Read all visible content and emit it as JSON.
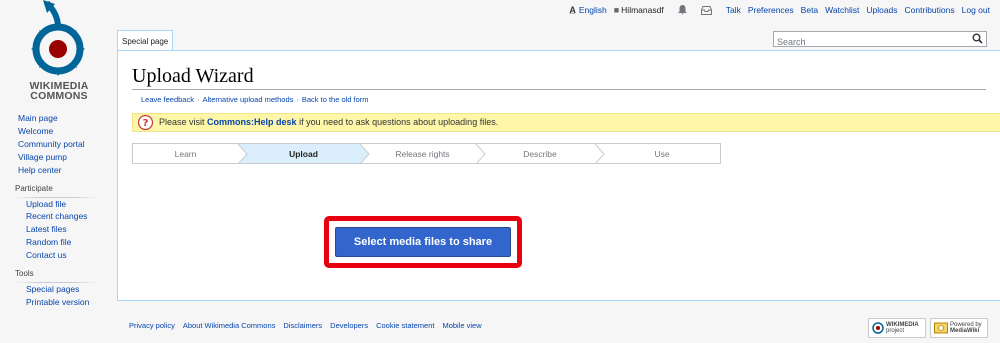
{
  "logo": {
    "line1": "WIKIMEDIA",
    "line2": "COMMONS"
  },
  "personal": {
    "language": "English",
    "username": "Hilmanasdf",
    "links": [
      "Talk",
      "Preferences",
      "Beta",
      "Watchlist",
      "Uploads",
      "Contributions",
      "Log out"
    ]
  },
  "tabs": {
    "special_page": "Special page"
  },
  "search": {
    "placeholder": "Search"
  },
  "page": {
    "title": "Upload Wizard",
    "sublinks": [
      "Leave feedback",
      "Alternative upload methods",
      "Back to the old form"
    ],
    "notice": {
      "before": "Please visit ",
      "link": "Commons:Help desk",
      "after": " if you need to ask questions about uploading files."
    }
  },
  "steps": [
    "Learn",
    "Upload",
    "Release rights",
    "Describe",
    "Use"
  ],
  "active_step": "Upload",
  "select_button": "Select media files to share",
  "sidebar": {
    "main": [
      "Main page",
      "Welcome",
      "Community portal",
      "Village pump",
      "Help center"
    ],
    "participate_heading": "Participate",
    "participate": [
      "Upload file",
      "Recent changes",
      "Latest files",
      "Random file",
      "Contact us"
    ],
    "tools_heading": "Tools",
    "tools": [
      "Special pages",
      "Printable version"
    ]
  },
  "footer": {
    "links": [
      "Privacy policy",
      "About Wikimedia Commons",
      "Disclaimers",
      "Developers",
      "Cookie statement",
      "Mobile view"
    ],
    "badge_wikimedia": {
      "line1": "WIKIMEDIA",
      "line2": "project"
    },
    "badge_mediawiki": {
      "line1": "Powered by",
      "line2": "MediaWiki"
    }
  },
  "colors": {
    "link": "#0645ad",
    "active_step_bg": "#dbeefb",
    "highlight": "#e8000f",
    "button": "#3366cc",
    "notice_bg": "#fef6a8"
  }
}
